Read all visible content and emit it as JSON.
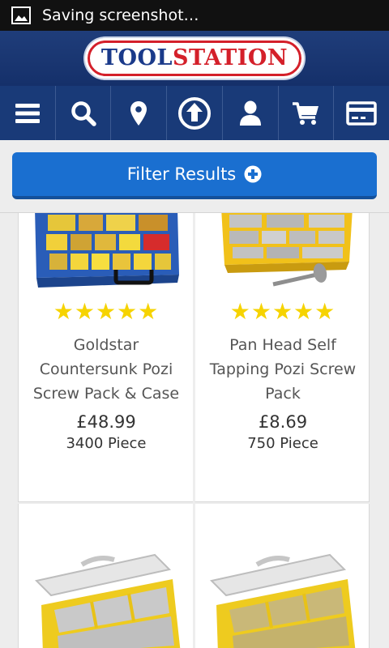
{
  "status_bar": {
    "icon": "image-icon",
    "text": "Saving screenshot…"
  },
  "header": {
    "logo_part1": "TOOL",
    "logo_part2": "STATION"
  },
  "nav": {
    "icons": [
      "menu-icon",
      "search-icon",
      "location-pin-icon",
      "upload-arrow-icon",
      "account-icon",
      "cart-icon",
      "credit-card-icon"
    ]
  },
  "filter": {
    "label": "Filter Results",
    "icon": "plus-circle-icon"
  },
  "products": [
    {
      "name_line1": "Goldstar",
      "name_line2": "Countersunk Pozi",
      "name_line3": "Screw Pack & Case",
      "price": "£48.99",
      "quantity": "3400 Piece",
      "rating": 5
    },
    {
      "name_line1": "Pan Head Self",
      "name_line2": "Tapping Pozi Screw",
      "name_line3": "Pack",
      "price": "£8.69",
      "quantity": "750 Piece",
      "rating": 5
    }
  ],
  "colors": {
    "header_blue": "#1f3d7a",
    "nav_blue": "#193a78",
    "filter_blue": "#1a6fd0",
    "star_yellow": "#f6d300",
    "logo_red": "#d4202a"
  }
}
